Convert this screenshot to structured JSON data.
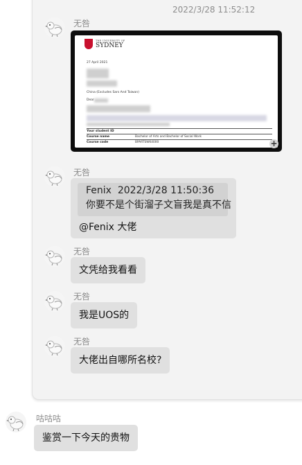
{
  "timestamp": "2022/3/28 11:52:12",
  "messages": [
    {
      "sender": "无咎",
      "type": "image"
    },
    {
      "sender": "无咎",
      "quote": {
        "author": "Fenix",
        "time": "2022/3/28 11:50:36",
        "text": "你要不是个街溜子文盲我是真不信"
      },
      "text": "@Fenix 大佬"
    },
    {
      "sender": "无咎",
      "text": "文凭给我看看"
    },
    {
      "sender": "无咎",
      "text": "我是UOS的"
    },
    {
      "sender": "无咎",
      "text": "大佬出自哪所名校?"
    }
  ],
  "bottom_message": {
    "sender": "咕咕咕",
    "text": "鉴赏一下今天的贵物"
  },
  "document": {
    "university_small": "THE UNIVERSITY OF",
    "university_big": "SYDNEY",
    "date": "27 April 2021",
    "country": "China (Excludes Sars And Taiwan)",
    "greeting": "Dear",
    "rows": [
      {
        "key": "Your student ID",
        "value": ""
      },
      {
        "key": "Course name",
        "value": "Bachelor of Arts and Bachelor of Social Work"
      },
      {
        "key": "Course code",
        "value": "BPARTSWK4000"
      }
    ],
    "zoom_label": "+"
  }
}
